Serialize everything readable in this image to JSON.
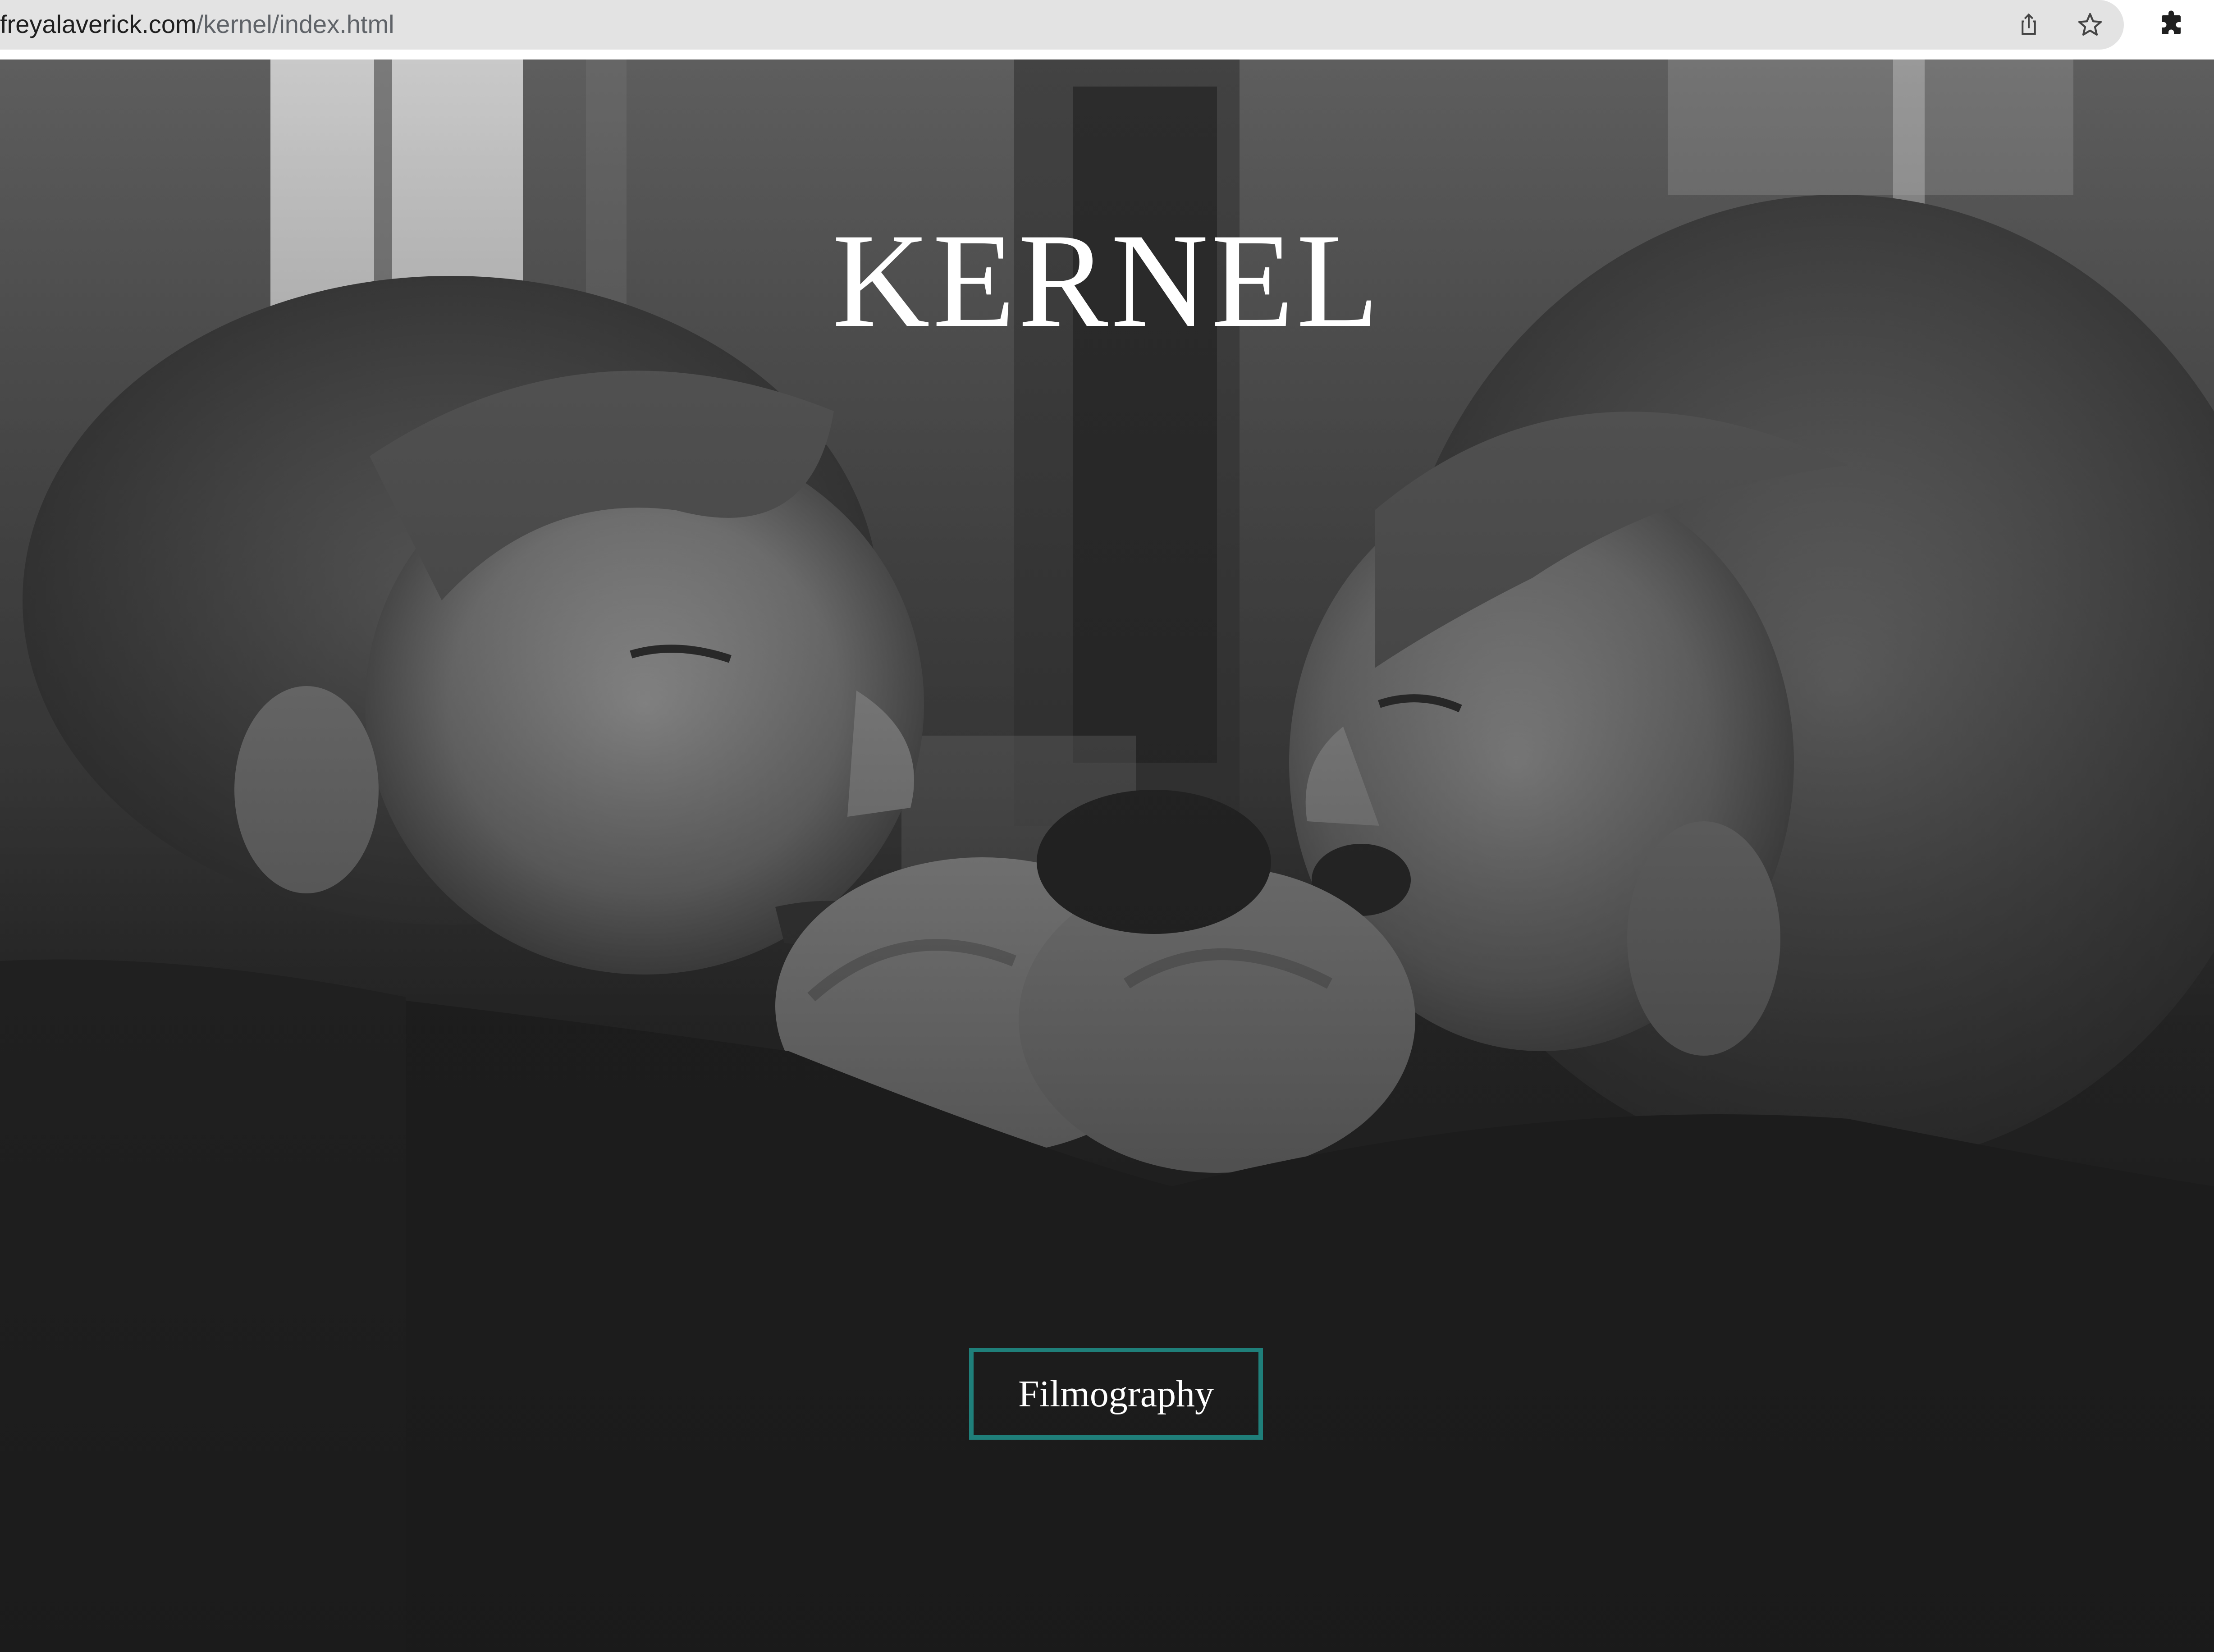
{
  "browser": {
    "url_domain": "freyalaverick.com",
    "url_path": "/kernel/index.html",
    "icons": {
      "share": "share-icon",
      "bookmark": "star-icon",
      "extensions": "puzzle-piece-icon"
    }
  },
  "page": {
    "title": "KERNEL",
    "cta_label": "Filmography",
    "hero_image": "black-and-white still of two women facing each other, clasping hands",
    "colors": {
      "background": "#1c1c1c",
      "title": "#ffffff",
      "button_border": "#1f7f7a",
      "button_text": "#ffffff"
    }
  }
}
